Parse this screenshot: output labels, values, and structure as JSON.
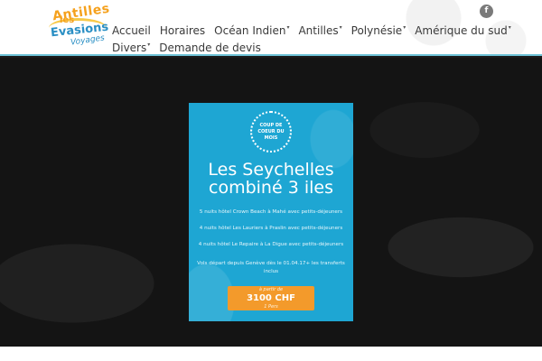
{
  "header": {
    "logo": {
      "line1": "Antilles",
      "line2": "les",
      "line3": "Evasions",
      "line4": "Voyages"
    },
    "nav": {
      "row1": [
        {
          "label": "Accueil",
          "dropdown": false
        },
        {
          "label": "Horaires",
          "dropdown": false
        },
        {
          "label": "Océan Indien",
          "dropdown": true
        },
        {
          "label": "Antilles",
          "dropdown": true
        },
        {
          "label": "Polynésie",
          "dropdown": true
        },
        {
          "label": "Amérique du sud",
          "dropdown": true
        }
      ],
      "row2": [
        {
          "label": "Divers",
          "dropdown": true
        },
        {
          "label": "Demande de devis",
          "dropdown": false
        }
      ]
    },
    "social": {
      "facebook": "f"
    }
  },
  "promo": {
    "badge": "COUP DE COEUR DU MOIS",
    "title": "Les Seychelles combiné 3 iles",
    "lines": [
      "5 nuits hôtel Crown Beach à Mahé avec petits-déjeuners",
      "4 nuits hôtel Les Lauriers à Praslin avec petits-déjeuners",
      "4 nuits hôtel Le Repaire à La Digue avec petits-déjeuners",
      "Vols départ depuis Genève dès le 01.04.17+ les transferts inclus"
    ],
    "cta": {
      "prefix": "à partir de",
      "price": "3100 CHF",
      "suffix": "1 Pers"
    }
  },
  "colors": {
    "accent": "#1ea6d3",
    "cta": "#f39a2b",
    "brand_orange": "#f5a11d",
    "brand_blue": "#2a8fc4"
  }
}
